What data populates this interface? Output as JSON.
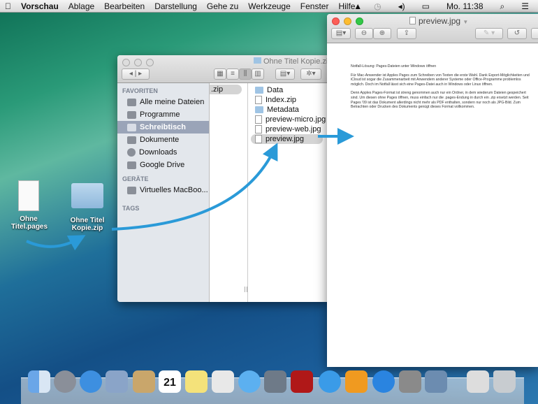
{
  "menubar": {
    "app": "Vorschau",
    "items": [
      "Ablage",
      "Bearbeiten",
      "Darstellung",
      "Gehe zu",
      "Werkzeuge",
      "Fenster",
      "Hilfe"
    ],
    "clock": "Mo. 11:38"
  },
  "finder": {
    "title": "Ohne Titel Kopie.zip",
    "sidebar": {
      "favorites_header": "FAVORITEN",
      "favorites": [
        "Alle meine Dateien",
        "Programme",
        "Schreibtisch",
        "Dokumente",
        "Downloads",
        "Google Drive"
      ],
      "devices_header": "GERÄTE",
      "devices": [
        "Virtuelles MacBoo..."
      ],
      "tags_header": "TAGS"
    },
    "column1": [
      ".zip"
    ],
    "column2": [
      "Data",
      "Index.zip",
      "Metadata",
      "preview-micro.jpg",
      "preview-web.jpg",
      "preview.jpg"
    ]
  },
  "preview": {
    "title": "preview.jpg",
    "doc": {
      "heading": "Notfall-Lösung: Pages-Dateien unter Windows öffnen",
      "p1": "Für Mac-Anwender ist Apples Pages zum Schreiben von Texten die erste Wahl. Dank Export-Möglichkeiten und iCloud ist sogar die Zusammenarbeit mit Anwendern anderer Systeme oder Office-Programme problemlos möglich. Doch im Notfall lässt sich eine Pages-Datei auch in Windows oder Linux öffnen.",
      "p2": "Denn Apples Pages-Format ist streng genommen auch nur ein Ordner, in dem wiederum Dateien gespeichert sind. Um diesen ohne Pages öffnen, muss einfach nur die .pages-Endung in durch ein .zip ersetzt werden. Seit Pages '09 ist das Dokument allerdings nicht mehr als PDF enthalten, sondern nur noch als JPG-Bild. Zum Betrachten oder Drucken des Dokuments genügt dieses Format vollkommen."
    }
  },
  "desktop": {
    "icons": [
      "Ohne Titel.pages",
      "Ohne Titel Kopie.zip"
    ]
  },
  "dock": {
    "calendar_day": "21"
  },
  "colors": {
    "arrow": "#2a9ad8",
    "selection": "#9aa4b8"
  }
}
